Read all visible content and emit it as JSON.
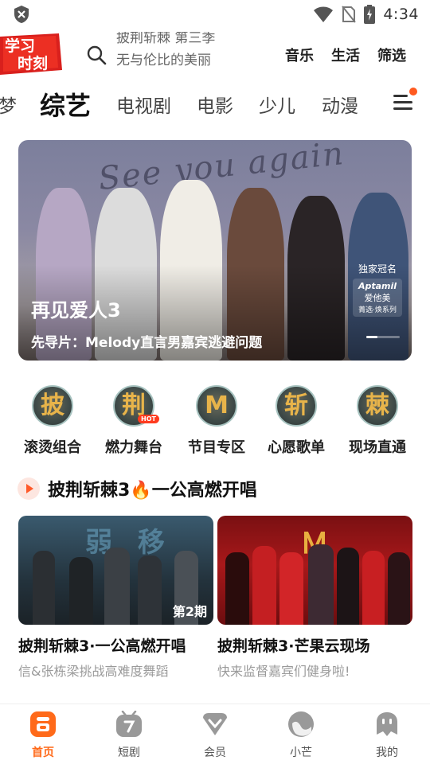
{
  "status_bar": {
    "time": "4:34"
  },
  "header": {
    "logo_text": [
      "学习",
      "时刻"
    ],
    "search_hints": [
      "披荆斩棘 第三季",
      "无与伦比的美丽"
    ],
    "links": [
      "音乐",
      "生活",
      "筛选"
    ]
  },
  "tabs": [
    "梦",
    "综艺",
    "电视剧",
    "电影",
    "少儿",
    "动漫"
  ],
  "active_tab": "综艺",
  "banner": {
    "script_text": "See you again",
    "title": "再见爱人3",
    "subtitle": "先导片：Melody直言男嘉宾逃避问题",
    "sponsor_label": "独家冠名",
    "sponsor_brand": "Aptamil",
    "sponsor_brand_cn": "爱他美",
    "sponsor_line": "菁选·焕系列"
  },
  "quick_links": [
    {
      "label": "滚烫组合",
      "glyph": "披",
      "icon": "pi-emblem-icon"
    },
    {
      "label": "燃力舞台",
      "glyph": "荆",
      "icon": "jing-emblem-icon",
      "badge": "HOT"
    },
    {
      "label": "节目专区",
      "glyph": "M",
      "icon": "logo-emblem-icon"
    },
    {
      "label": "心愿歌单",
      "glyph": "斩",
      "icon": "zhan-emblem-icon"
    },
    {
      "label": "现场直通",
      "glyph": "棘",
      "icon": "ji-emblem-icon"
    }
  ],
  "section": {
    "title": "披荆斩棘3🔥一公高燃开唱"
  },
  "cards": [
    {
      "title": "披荆斩棘3·一公高燃开唱",
      "subtitle": "信&张栋梁挑战高难度舞蹈",
      "badge": "第2期",
      "thumb_text": "弱 移"
    },
    {
      "title": "披荆斩棘3·芒果云现场",
      "subtitle": "快来监督嘉宾们健身啦!"
    }
  ],
  "bottom_nav": [
    {
      "label": "首页",
      "icon": "home-icon",
      "active": true
    },
    {
      "label": "短剧",
      "icon": "short-drama-icon",
      "active": false
    },
    {
      "label": "会员",
      "icon": "vip-icon",
      "active": false
    },
    {
      "label": "小芒",
      "icon": "xiaomang-icon",
      "active": false
    },
    {
      "label": "我的",
      "icon": "profile-icon",
      "active": false
    }
  ],
  "colors": {
    "accent": "#ff6a1a",
    "notice_dot": "#ff5a1f"
  }
}
